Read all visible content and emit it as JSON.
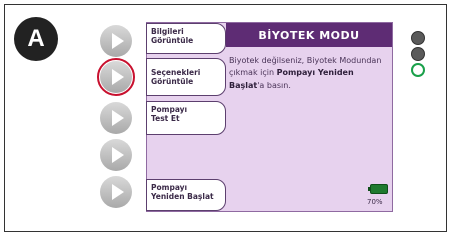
{
  "figure_label": "A",
  "device": {
    "header_title": "BİYOTEK MODU",
    "tabs": [
      {
        "label_line1": "Bilgileri",
        "label_line2": "Görüntüle"
      },
      {
        "label_line1": "Seçenekleri",
        "label_line2": "Görüntüle"
      },
      {
        "label_line1": "Pompayı",
        "label_line2": "Test Et"
      },
      {
        "label_line1": "Pompayı",
        "label_line2": "Yeniden Başlat"
      }
    ],
    "message": {
      "part1": "Biyotek değilseniz, Biyotek Modundan çıkmak için ",
      "bold": "Pompayı Yeniden Başlat",
      "part2": "'a basın."
    },
    "battery": {
      "level_percent": 70,
      "label": "70%",
      "color": "#1f7a2f"
    },
    "status_lights": [
      {
        "name": "light-1",
        "color": "#5a5a5a",
        "state": "off"
      },
      {
        "name": "light-2",
        "color": "#5a5a5a",
        "state": "off"
      },
      {
        "name": "light-3",
        "color": "#1aa04a",
        "state": "on"
      }
    ]
  },
  "highlight": {
    "button_index": 2,
    "color": "#c8102e"
  }
}
